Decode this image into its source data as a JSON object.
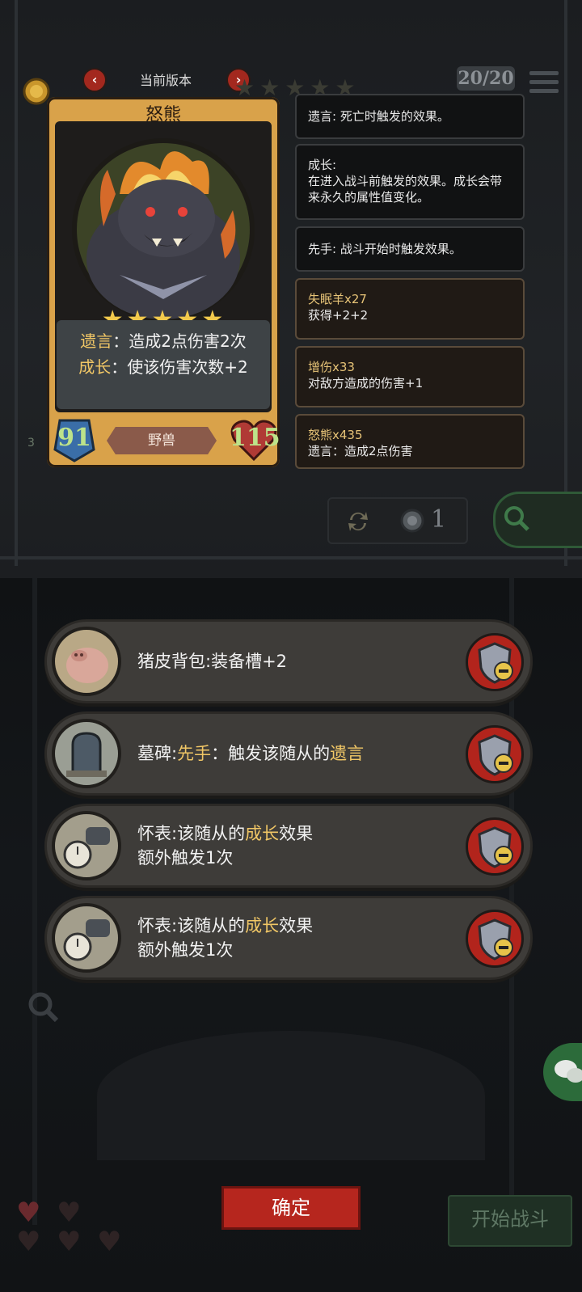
{
  "header": {
    "version_label": "当前版本",
    "prev_arrow": "‹",
    "next_arrow": "›",
    "count": "20/20"
  },
  "card": {
    "name": "怒熊",
    "stars": "★★★★★",
    "desc_line1_keyword": "遗言",
    "desc_line1_text": "：造成2点伤害2次",
    "desc_line2_keyword": "成长",
    "desc_line2_text": "：使该伤害次数+2",
    "attack": "91",
    "health": "115",
    "tribe": "野兽",
    "side_number": "3"
  },
  "tooltips": [
    {
      "title": "遗言",
      "body": ": 死亡时触发的效果。"
    },
    {
      "title": "成长:",
      "body": "在进入战斗前触发的效果。成长会带来永久的属性值变化。"
    },
    {
      "title": "先手",
      "body": ": 战斗开始时触发效果。"
    },
    {
      "title": "失眠羊x27",
      "body": "获得+2+2"
    },
    {
      "title": "增伤x33",
      "body": "对敌方造成的伤害+1"
    },
    {
      "title": "怒熊x435",
      "body": "遗言：造成2点伤害"
    }
  ],
  "refresh": {
    "count": "1"
  },
  "items": [
    {
      "line1_pre": "猪皮背包:装备槽+2",
      "line1_kw": "",
      "line1_post": "",
      "line1_kw2": "",
      "line2": ""
    },
    {
      "line1_pre": "墓碑:",
      "line1_kw": "先手",
      "line1_post": "：触发该随从的",
      "line1_kw2": "遗言",
      "line2": ""
    },
    {
      "line1_pre": "怀表:该随从的",
      "line1_kw": "成长",
      "line1_post": "效果",
      "line1_kw2": "",
      "line2": "额外触发1次"
    },
    {
      "line1_pre": "怀表:该随从的",
      "line1_kw": "成长",
      "line1_post": "效果",
      "line1_kw2": "",
      "line2": "额外触发1次"
    }
  ],
  "buttons": {
    "confirm": "确定",
    "start_battle": "开始战斗"
  },
  "colors": {
    "keyword_gold": "#f1c766",
    "card_gold": "#d9a24a",
    "remove_red": "#b2241c"
  }
}
